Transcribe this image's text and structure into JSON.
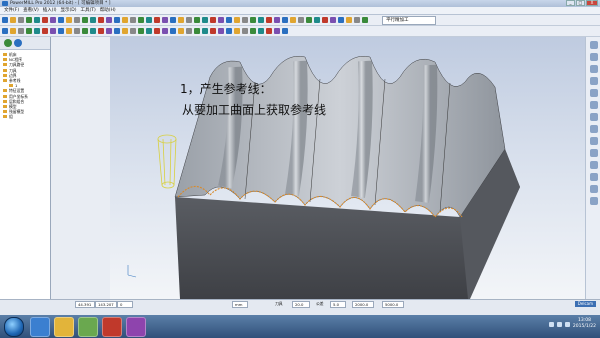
{
  "window": {
    "title": "PowerMILL Pro 2012 (64-bit) - [ 可编辑项目 * ]",
    "controls": [
      "_",
      "□",
      "X"
    ]
  },
  "menubar": {
    "items": [
      "文件(F)",
      "查看(V)",
      "插入(I)",
      "显示(D)",
      "工具(T)",
      "帮助(H)"
    ]
  },
  "toolbar": {
    "feedrate_label": "平行精加工"
  },
  "explorer": {
    "items": [
      {
        "label": "机床",
        "level": 1
      },
      {
        "label": "NC程序",
        "level": 1
      },
      {
        "label": "刀具路径",
        "level": 1
      },
      {
        "label": "刀具",
        "level": 1
      },
      {
        "label": "边界",
        "level": 1
      },
      {
        "label": "参考线",
        "level": 1
      },
      {
        "label": "1",
        "level": 2
      },
      {
        "label": "特征设置",
        "level": 1
      },
      {
        "label": "用户坐标系",
        "level": 1
      },
      {
        "label": "层和组合",
        "level": 1
      },
      {
        "label": "模型",
        "level": 1
      },
      {
        "label": "残留模型",
        "level": 1
      },
      {
        "label": "组",
        "level": 1
      }
    ]
  },
  "viewport": {
    "caption_line1": "1，产生参考线：",
    "caption_line2": "从要加工曲面上获取参考线",
    "colors": {
      "surface_light": "#c9cdd3",
      "surface_dark": "#4a4d53",
      "reference_line": "#d98a2a",
      "tool": "#e6e35a"
    }
  },
  "statusbar": {
    "fields": [
      "44.391",
      "143.207",
      "0",
      "mm",
      "20.0",
      "5.0",
      "2000.0",
      "5000.0"
    ],
    "labels": [
      "刀具",
      "公差"
    ],
    "badge": "Delcam"
  },
  "taskbar": {
    "time": "13:08",
    "date": "2015/1/22"
  }
}
